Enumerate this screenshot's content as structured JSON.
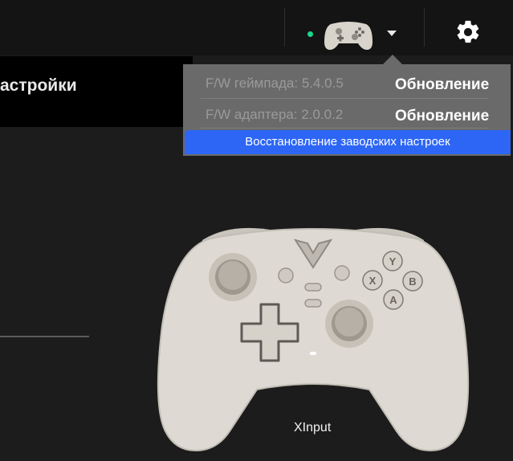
{
  "header": {
    "connection_status_color": "#1bd68a",
    "device_thumbnail": "controller-thumbnail-icon",
    "dropdown_icon": "caret-down-icon",
    "settings_icon": "gear-icon"
  },
  "page": {
    "title": "астройки"
  },
  "firmware_popup": {
    "gamepad_fw": "F/W геймпада: 5.4.0.5",
    "gamepad_update": "Обновление",
    "adapter_fw": "F/W адаптера: 2.0.0.2",
    "adapter_update": "Обновление",
    "factory_reset": "Восстановление заводских настроек",
    "accent_color": "#2d66f5"
  },
  "controller": {
    "image": "gamepad-image",
    "mode": "XInput"
  }
}
